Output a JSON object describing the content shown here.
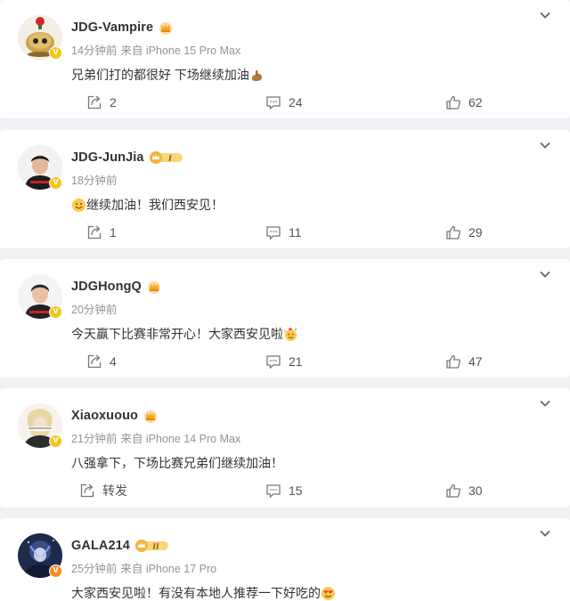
{
  "colors": {
    "page_bg": "#f1f2f5",
    "card_bg": "#ffffff",
    "text": "#333333",
    "meta": "#939393",
    "verified_yellow": "#f5c518",
    "verified_orange": "#f78b1e"
  },
  "posts": [
    {
      "username": "JDG-Vampire",
      "time": "14分钟前",
      "source": "来自 iPhone 15 Pro Max",
      "content": "兄弟们打的都很好 下场继续加油",
      "content_emoji": "strong-arm-emoji",
      "verified": "yellow",
      "reposts": "2",
      "comments": "24",
      "likes": "62"
    },
    {
      "username": "JDG-JunJia",
      "time": "18分钟前",
      "source": "",
      "content": "继续加油！我们西安见！",
      "content_emoji_prefix": "smile-emoji",
      "verified": "yellow",
      "level_badge": "I",
      "reposts": "1",
      "comments": "11",
      "likes": "29"
    },
    {
      "username": "JDGHongQ",
      "time": "20分钟前",
      "source": "",
      "content": "今天赢下比赛非常开心！大家西安见啦",
      "content_emoji": "party-emoji",
      "verified": "yellow",
      "reposts": "4",
      "comments": "21",
      "likes": "47"
    },
    {
      "username": "Xiaoxuouo",
      "time": "21分钟前",
      "source": "来自 iPhone 14 Pro Max",
      "content": "八强拿下，下场比赛兄弟们继续加油！",
      "verified": "yellow",
      "repost_label": "转发",
      "comments": "15",
      "likes": "30"
    },
    {
      "username": "GALA214",
      "time": "25分钟前",
      "source": "来自 iPhone 17 Pro",
      "content": "大家西安见啦！有没有本地人推荐一下好吃的",
      "content_emoji": "heart-eyes-emoji",
      "verified": "orange",
      "level_badge": "II"
    }
  ]
}
